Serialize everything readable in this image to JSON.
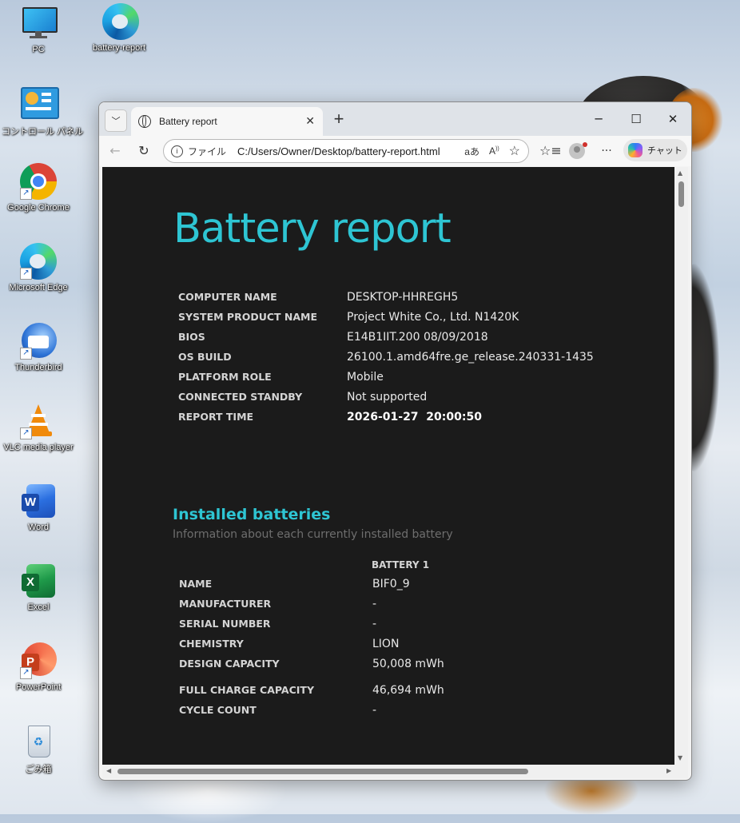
{
  "desktop": {
    "icons": [
      {
        "name": "PC",
        "label": "PC"
      },
      {
        "name": "battery-report",
        "label": "battery-report"
      },
      {
        "name": "control-panel",
        "label": "コントロール パネル"
      },
      {
        "name": "chrome",
        "label": "Google Chrome"
      },
      {
        "name": "edge",
        "label": "Microsoft Edge"
      },
      {
        "name": "thunderbird",
        "label": "Thunderbird"
      },
      {
        "name": "vlc",
        "label": "VLC media player"
      },
      {
        "name": "word",
        "label": "Word"
      },
      {
        "name": "excel",
        "label": "Excel"
      },
      {
        "name": "powerpoint",
        "label": "PowerPoint"
      },
      {
        "name": "recycle-bin",
        "label": "ごみ箱"
      }
    ]
  },
  "browser": {
    "tab_title": "Battery report",
    "address_scheme": "ファイル",
    "address_url": "C:/Users/Owner/Desktop/battery-report.html",
    "read_aloud": "aあ",
    "copilot_label": "チャット"
  },
  "report": {
    "title": "Battery report",
    "system_info": [
      {
        "key": "COMPUTER NAME",
        "value": "DESKTOP-HHREGH5"
      },
      {
        "key": "SYSTEM PRODUCT NAME",
        "value": "Project White Co., Ltd. N1420K"
      },
      {
        "key": "BIOS",
        "value": "E14B1IIT.200 08/09/2018"
      },
      {
        "key": "OS BUILD",
        "value": "26100.1.amd64fre.ge_release.240331-1435"
      },
      {
        "key": "PLATFORM ROLE",
        "value": "Mobile"
      },
      {
        "key": "CONNECTED STANDBY",
        "value": "Not supported"
      },
      {
        "key": "REPORT TIME",
        "value": "2026-01-27  20:00:50"
      }
    ],
    "installed": {
      "title": "Installed batteries",
      "subtitle": "Information about each currently installed battery",
      "column": "BATTERY 1",
      "rows": [
        {
          "key": "NAME",
          "value": "BIF0_9"
        },
        {
          "key": "MANUFACTURER",
          "value": "-"
        },
        {
          "key": "SERIAL NUMBER",
          "value": "-"
        },
        {
          "key": "CHEMISTRY",
          "value": "LION"
        },
        {
          "key": "DESIGN CAPACITY",
          "value": "50,008 mWh"
        },
        {
          "key": "FULL CHARGE CAPACITY",
          "value": "46,694 mWh"
        },
        {
          "key": "CYCLE COUNT",
          "value": "-"
        }
      ]
    }
  }
}
